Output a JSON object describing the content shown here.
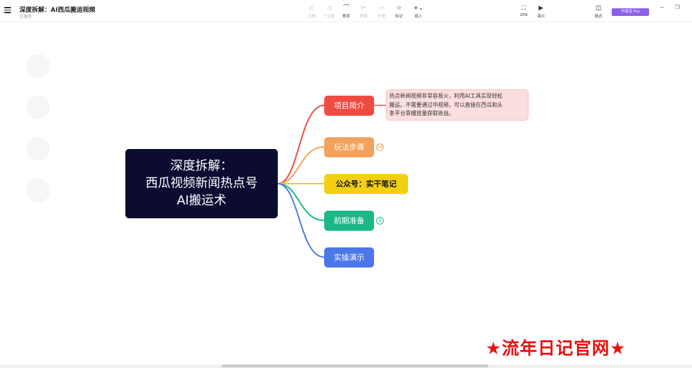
{
  "header": {
    "title": "深度拆解：AI西瓜搬运视频",
    "status": "已保存"
  },
  "toolbar": {
    "tools": [
      {
        "key": "sub",
        "label": "主题",
        "icon": "⊏",
        "disabled": true
      },
      {
        "key": "child",
        "label": "子主题",
        "icon": "⊐",
        "disabled": true
      },
      {
        "key": "link",
        "label": "联系",
        "icon": "⌒",
        "disabled": false
      },
      {
        "key": "summary",
        "label": "概要",
        "icon": "⊨",
        "disabled": true
      },
      {
        "key": "frame",
        "label": "外框",
        "icon": "▭",
        "disabled": true
      },
      {
        "key": "mark",
        "label": "标记",
        "icon": "☆",
        "disabled": false
      },
      {
        "key": "insert",
        "label": "插入",
        "icon": "+⌄",
        "disabled": false
      }
    ],
    "zen_label": "ZEN",
    "present_label": "演示",
    "format_label": "格式",
    "upgrade_label": "升级至 Pro"
  },
  "window": {
    "minimize_icon": "−",
    "restore_icon": "❐"
  },
  "mindmap": {
    "root_lines": [
      "深度拆解：",
      "西瓜视频新闻热点号",
      "AI搬运术"
    ],
    "topics": [
      {
        "key": "intro",
        "label": "项目简介",
        "color": "#ef4b43"
      },
      {
        "key": "steps",
        "label": "玩法步骤",
        "color": "#f2a25a",
        "badge": "19"
      },
      {
        "key": "wechat",
        "label": "公众号：实干笔记",
        "color": "#f2cf13"
      },
      {
        "key": "prep",
        "label": "前期准备",
        "color": "#1bb887",
        "badge": "6"
      },
      {
        "key": "demo",
        "label": "实操演示",
        "color": "#4c77ea"
      }
    ],
    "note_lines": [
      "热点新闻视频非常容易火，利用AI工具实现轻松",
      "搬运。不需要通过中视频，可以直接在西瓜和头",
      "条平台靠播放量获取收益。"
    ]
  },
  "watermark": "★流年日记官网★"
}
